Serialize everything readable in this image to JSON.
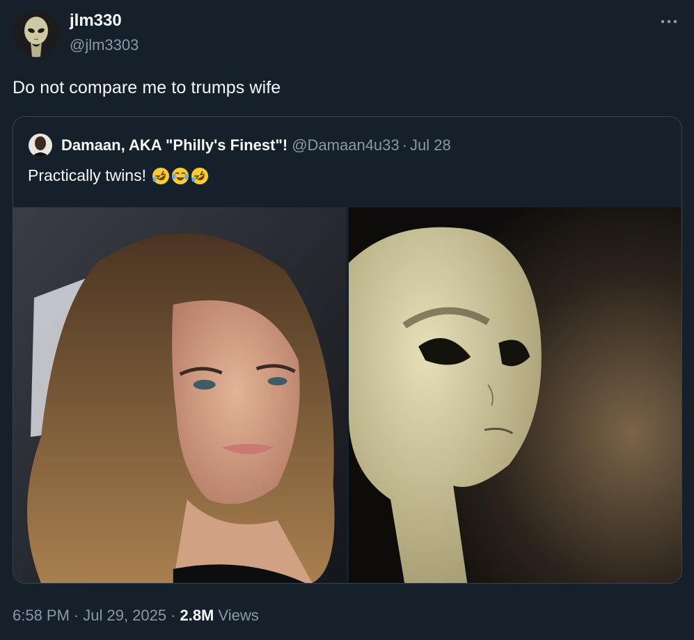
{
  "author": {
    "display_name": "jlm330",
    "handle": "@jlm3303",
    "avatar_icon": "alien-avatar"
  },
  "tweet": {
    "text": "Do not compare me to trumps wife"
  },
  "quote": {
    "display_name": "Damaan, AKA \"Philly's Finest\"!",
    "handle": "@Damaan4u33",
    "separator": "·",
    "date": "Jul 28",
    "text": "Practically twins!",
    "emojis": [
      "rolling-on-floor-laughing-emoji",
      "tears-of-joy-emoji",
      "rolling-on-floor-laughing-emoji"
    ],
    "media": [
      {
        "name": "woman-portrait-photo"
      },
      {
        "name": "grey-alien-photo"
      }
    ]
  },
  "meta": {
    "time": "6:58 PM",
    "separator": "·",
    "date": "Jul 29, 2025",
    "views_count": "2.8M",
    "views_label": "Views"
  },
  "colors": {
    "background": "#15202b",
    "text_primary": "#f7f9f9",
    "text_secondary": "#8b98a5",
    "border": "#38444d"
  }
}
